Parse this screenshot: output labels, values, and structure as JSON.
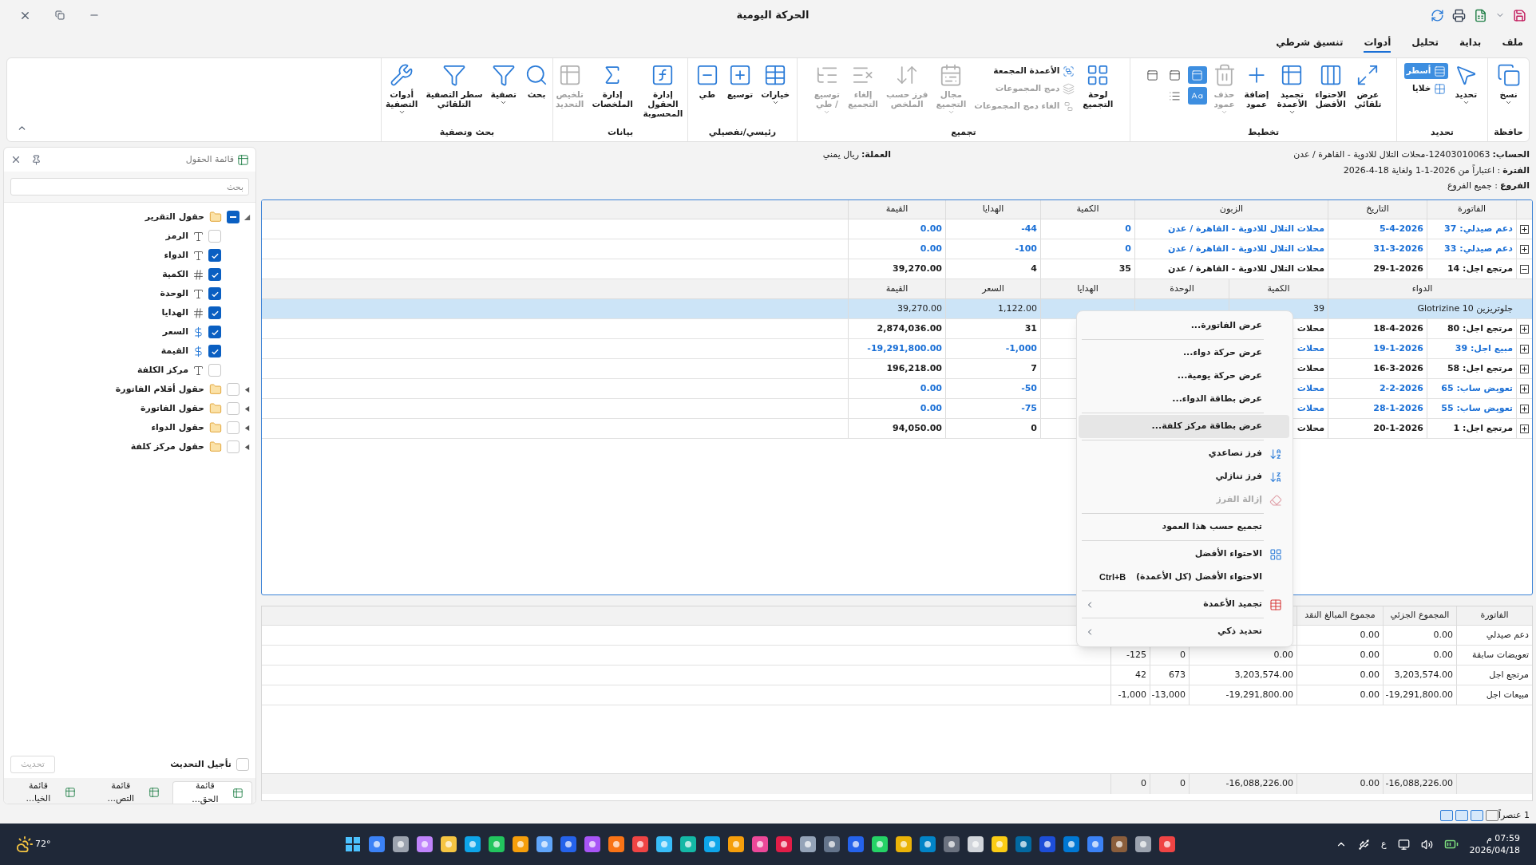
{
  "window": {
    "title": "الحركة اليومية"
  },
  "menu_tabs": [
    {
      "label": "ملف",
      "selected": false
    },
    {
      "label": "بداية",
      "selected": false
    },
    {
      "label": "تحليل",
      "selected": false
    },
    {
      "label": "أدوات",
      "selected": true
    },
    {
      "label": "تنسيق شرطي",
      "selected": false
    }
  ],
  "ribbon": {
    "groups": [
      {
        "label": "حافظة",
        "buttons": [
          {
            "label": "نسخ",
            "kind": "large",
            "dropdown": true,
            "disabled": false,
            "selected": false
          }
        ]
      },
      {
        "label": "تحديد",
        "buttons": [
          {
            "label": "تحديد",
            "kind": "large",
            "dropdown": true,
            "disabled": false,
            "selected": false
          },
          {
            "label": "أسطر",
            "kind": "small",
            "disabled": false,
            "selected": true
          },
          {
            "label": "خلايا",
            "kind": "small",
            "disabled": false,
            "selected": false
          }
        ]
      },
      {
        "label": "تخطيط",
        "buttons": [
          {
            "label": "عرض\nتلقائي",
            "kind": "large",
            "dropdown": false,
            "disabled": false,
            "selected": false
          },
          {
            "label": "الاحتواء\nالأفضل",
            "kind": "large",
            "dropdown": false,
            "disabled": false,
            "selected": false
          },
          {
            "label": "تجميد\nالأعمدة",
            "kind": "large",
            "dropdown": true,
            "disabled": false,
            "selected": false
          },
          {
            "label": "إضافة\nعمود",
            "kind": "large",
            "dropdown": false,
            "disabled": false,
            "selected": false
          },
          {
            "label": "حذف\nعمود",
            "kind": "large",
            "dropdown": true,
            "disabled": true,
            "selected": false
          },
          {
            "kind": "icon",
            "selected": true
          },
          {
            "kind": "icon",
            "selected": false
          },
          {
            "kind": "icon",
            "selected": false
          },
          {
            "kind": "icon",
            "selected": true
          },
          {
            "kind": "icon",
            "selected": false
          }
        ]
      },
      {
        "label": "تجميع",
        "buttons": [
          {
            "label": "لوحة\nالتجميع",
            "kind": "large",
            "dropdown": false,
            "disabled": false,
            "selected": false
          },
          {
            "label": "الأعمدة المجمعة",
            "kind": "small",
            "disabled": false,
            "selected": false
          },
          {
            "label": "دمج المجموعات",
            "kind": "small",
            "disabled": true,
            "selected": false
          },
          {
            "label": "الغاء دمج المجموعات",
            "kind": "small",
            "disabled": true,
            "selected": false
          },
          {
            "label": "مجال\nالتجميع",
            "kind": "large",
            "dropdown": true,
            "disabled": true,
            "selected": false
          },
          {
            "label": "فرز حسب\nالملخص",
            "kind": "large",
            "dropdown": false,
            "disabled": true,
            "selected": false
          },
          {
            "label": "إلغاء\nالتجميع",
            "kind": "large",
            "dropdown": false,
            "disabled": true,
            "selected": false
          },
          {
            "label": "توسيع\n/ طي",
            "kind": "large",
            "dropdown": true,
            "disabled": true,
            "selected": false
          }
        ]
      },
      {
        "label": "رئيسي/تفصيلي",
        "buttons": [
          {
            "label": "خيارات",
            "kind": "large",
            "dropdown": true,
            "disabled": false,
            "selected": false
          },
          {
            "label": "توسيع",
            "kind": "large",
            "dropdown": false,
            "disabled": false,
            "selected": false
          },
          {
            "label": "طي",
            "kind": "large",
            "dropdown": false,
            "disabled": false,
            "selected": false
          }
        ]
      },
      {
        "label": "بيانات",
        "buttons": [
          {
            "label": "إدارة الحقول\nالمحسوبة",
            "kind": "large",
            "dropdown": false,
            "disabled": false,
            "selected": false
          },
          {
            "label": "إدارة\nالملخصات",
            "kind": "large",
            "dropdown": false,
            "disabled": false,
            "selected": false
          },
          {
            "label": "تلخيص\nالتحديد",
            "kind": "large",
            "dropdown": false,
            "disabled": true,
            "selected": false
          }
        ]
      },
      {
        "label": "بحث وتصفية",
        "buttons": [
          {
            "label": "بحث",
            "kind": "large",
            "dropdown": false,
            "disabled": false,
            "selected": false
          },
          {
            "label": "تصفية",
            "kind": "large",
            "dropdown": true,
            "disabled": false,
            "selected": false
          },
          {
            "label": "سطر التصفية\nالتلقائي",
            "kind": "large",
            "dropdown": false,
            "disabled": false,
            "selected": false
          },
          {
            "label": "أدوات\nالتصفية",
            "kind": "large",
            "dropdown": true,
            "disabled": false,
            "selected": false
          }
        ]
      }
    ]
  },
  "info": [
    {
      "label": "الحساب:",
      "value": "12403010063-محلات التلال للادوية - القاهرة / عدن"
    },
    {
      "label": "الفترة",
      "value": ": اعتباراً من 2026-1-1 ولغاية 18-4-2026"
    },
    {
      "label": "الفروع",
      "value": ": جميع الفروع"
    }
  ],
  "currency": {
    "label": "العملة:",
    "value": "ريال يمني"
  },
  "main_grid": {
    "columns": [
      "الفاتورة",
      "التاريخ",
      "الزبون",
      "الكمية",
      "الهدايا",
      "القيمة"
    ],
    "rows": [
      {
        "invoice": "دعم صيدلي: 37",
        "date": "5-4-2026",
        "customer": "محلات التلال للادوية - القاهرة / عدن",
        "quantity": "0",
        "gifts": "-44",
        "value": "0.00",
        "color": "#1a6fd6",
        "expanded": false
      },
      {
        "invoice": "دعم صيدلي: 33",
        "date": "31-3-2026",
        "customer": "محلات التلال للادوية - القاهرة / عدن",
        "quantity": "0",
        "gifts": "-100",
        "value": "0.00",
        "color": "#1a6fd6",
        "expanded": false
      },
      {
        "invoice": "مرتجع اجل: 14",
        "date": "29-1-2026",
        "customer": "محلات التلال للادوية - القاهرة / عدن",
        "quantity": "35",
        "gifts": "4",
        "value": "39,270.00",
        "color": "#1b1b1b",
        "expanded": true,
        "detail": {
          "columns": [
            "الدواء",
            "الكمية",
            "الوحدة",
            "الهدايا",
            "السعر",
            "القيمة"
          ],
          "rows": [
            {
              "drug": "جلوتريزين 10 Glotrizine",
              "quantity": "39",
              "price": "1,122.00",
              "value": "39,270.00",
              "selected": true
            }
          ]
        }
      },
      {
        "invoice": "مرتجع اجل: 80",
        "date": "18-4-2026",
        "customer": "محلات",
        "gifts": "31",
        "value": "2,874,036.00",
        "color": "#1b1b1b",
        "expanded": false
      },
      {
        "invoice": "مبيع اجل: 39",
        "date": "19-1-2026",
        "customer": "محلات",
        "gifts": "-1,000",
        "value": "-19,291,800.00",
        "color": "#1a6fd6",
        "expanded": false
      },
      {
        "invoice": "مرتجع اجل: 58",
        "date": "16-3-2026",
        "customer": "محلات",
        "gifts": "7",
        "value": "196,218.00",
        "color": "#1b1b1b",
        "expanded": false
      },
      {
        "invoice": "تعويض ساب: 65",
        "date": "2-2-2026",
        "customer": "محلات",
        "gifts": "-50",
        "value": "0.00",
        "color": "#1a6fd6",
        "expanded": false
      },
      {
        "invoice": "تعويض ساب: 55",
        "date": "28-1-2026",
        "customer": "محلات",
        "gifts": "-75",
        "value": "0.00",
        "color": "#1a6fd6",
        "expanded": false
      },
      {
        "invoice": "مرتجع اجل: 1",
        "date": "20-1-2026",
        "customer": "محلات",
        "gifts": "0",
        "value": "94,050.00",
        "color": "#1b1b1b",
        "expanded": false
      }
    ]
  },
  "summary_grid": {
    "columns": [
      "الفاتورة",
      "المجموع الجزئي",
      "مجموع المبالغ النقد"
    ],
    "rows": [
      [
        "دعم صيدلي",
        "0.00",
        "0.00"
      ],
      [
        "تعويضات سابقة",
        "0.00",
        "0.00",
        "0.00",
        "0",
        "-125"
      ],
      [
        "مرتجع اجل",
        "3,203,574.00",
        "0.00",
        "3,203,574.00",
        "673",
        "42"
      ],
      [
        "مبيعات اجل",
        "-19,291,800.00",
        "0.00",
        "-19,291,800.00",
        "-13,000",
        "-1,000"
      ]
    ],
    "totals": [
      "-16,088,226.00",
      "0.00",
      "-16,088,226.00",
      "0",
      "0"
    ]
  },
  "context_menu": [
    {
      "kind": "item",
      "label": "عرض الفاتورة...",
      "selected": false,
      "disabled": false,
      "submenu": false
    },
    {
      "kind": "separator"
    },
    {
      "kind": "item",
      "label": "عرض حركة دواء...",
      "selected": false,
      "disabled": false,
      "submenu": false
    },
    {
      "kind": "item",
      "label": "عرض حركة يومية...",
      "selected": false,
      "disabled": false,
      "submenu": false
    },
    {
      "kind": "item",
      "label": "عرض بطاقة الدواء...",
      "selected": false,
      "disabled": false,
      "submenu": false
    },
    {
      "kind": "separator"
    },
    {
      "kind": "item",
      "label": "عرض بطاقة مركز كلفة...",
      "selected": true,
      "disabled": false,
      "submenu": false
    },
    {
      "kind": "separator"
    },
    {
      "kind": "item",
      "label": "فرز تصاعدي",
      "selected": false,
      "disabled": false,
      "submenu": false
    },
    {
      "kind": "item",
      "label": "فرز تنازلي",
      "selected": false,
      "disabled": false,
      "submenu": false
    },
    {
      "kind": "item",
      "label": "إزالة الفرز",
      "selected": false,
      "disabled": true,
      "submenu": false
    },
    {
      "kind": "separator"
    },
    {
      "kind": "item",
      "label": "تجميع حسب هذا العمود",
      "selected": false,
      "disabled": false,
      "submenu": false
    },
    {
      "kind": "separator"
    },
    {
      "kind": "item",
      "label": "الاحتواء الأفضل",
      "selected": false,
      "disabled": false,
      "submenu": false
    },
    {
      "kind": "item",
      "label": "الاحتواء الأفضل (كل الأعمدة)",
      "shortcut": "Ctrl+B",
      "selected": false,
      "disabled": false,
      "submenu": false
    },
    {
      "kind": "separator"
    },
    {
      "kind": "item",
      "label": "تجميد الأعمدة",
      "selected": false,
      "disabled": false,
      "submenu": true
    },
    {
      "kind": "separator"
    },
    {
      "kind": "item",
      "label": "تحديد ذكي",
      "selected": false,
      "disabled": false,
      "submenu": true
    }
  ],
  "field_list": {
    "title": "قائمة الحقول",
    "search": {
      "placeholder": "بحث"
    },
    "tree": [
      {
        "label": "حقول التقرير",
        "expanded": true,
        "checked": true,
        "partial": true,
        "children": [
          {
            "label": "الرمز",
            "kind": "text",
            "checked": false
          },
          {
            "label": "الدواء",
            "kind": "text",
            "checked": true
          },
          {
            "label": "الكمية",
            "kind": "number",
            "checked": true
          },
          {
            "label": "الوحدة",
            "kind": "text",
            "checked": true
          },
          {
            "label": "الهدايا",
            "kind": "number",
            "checked": true
          },
          {
            "label": "السعر",
            "kind": "currency",
            "checked": true
          },
          {
            "label": "القيمة",
            "kind": "currency",
            "checked": true
          },
          {
            "label": "مركز الكلفة",
            "kind": "text",
            "checked": false
          }
        ]
      },
      {
        "label": "حقول أقلام الفاتورة",
        "expanded": false,
        "checked": false,
        "partial": false
      },
      {
        "label": "حقول الفاتورة",
        "expanded": false,
        "checked": false,
        "partial": false
      },
      {
        "label": "حقول الدواء",
        "expanded": false,
        "checked": false,
        "partial": false
      },
      {
        "label": "حقول مركز كلفة",
        "expanded": false,
        "checked": false,
        "partial": false
      }
    ],
    "defer": {
      "label": "تأجيل التحديث",
      "checked": false
    },
    "update_button": {
      "label": "تحديث",
      "disabled": true
    },
    "tabs": [
      {
        "label": "قائمة الحق...",
        "selected": true
      },
      {
        "label": "قائمة التص...",
        "selected": false
      },
      {
        "label": "قائمة الخيا...",
        "selected": false
      }
    ]
  },
  "status_bar": {
    "count": "1 عنصراً"
  },
  "taskbar": {
    "weather": "72°",
    "language": "ع",
    "time": "07:59 م",
    "date": "2026/04/18"
  }
}
